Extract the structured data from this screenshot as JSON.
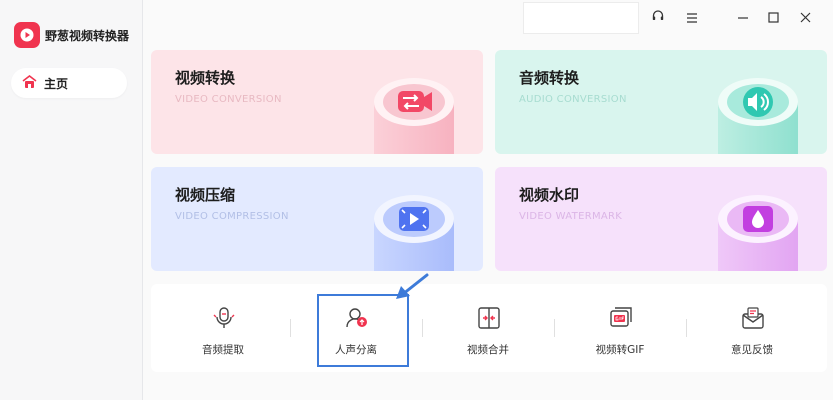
{
  "app": {
    "title": "野葱视频转换器"
  },
  "sidebar": {
    "home_label": "主页"
  },
  "cards": [
    {
      "title": "视频转换",
      "subtitle": "VIDEO CONVERSION"
    },
    {
      "title": "音频转换",
      "subtitle": "AUDIO CONVERSION"
    },
    {
      "title": "视频压缩",
      "subtitle": "VIDEO COMPRESSION"
    },
    {
      "title": "视频水印",
      "subtitle": "VIDEO WATERMARK"
    }
  ],
  "tools": [
    {
      "label": "音频提取",
      "icon": "microphone-icon"
    },
    {
      "label": "人声分离",
      "icon": "voice-separation-icon"
    },
    {
      "label": "视频合并",
      "icon": "video-merge-icon"
    },
    {
      "label": "视频转GIF",
      "icon": "gif-icon"
    },
    {
      "label": "意见反馈",
      "icon": "feedback-mail-icon"
    }
  ],
  "colors": {
    "brand": "#f0344f",
    "highlight": "#3d7bd9"
  }
}
